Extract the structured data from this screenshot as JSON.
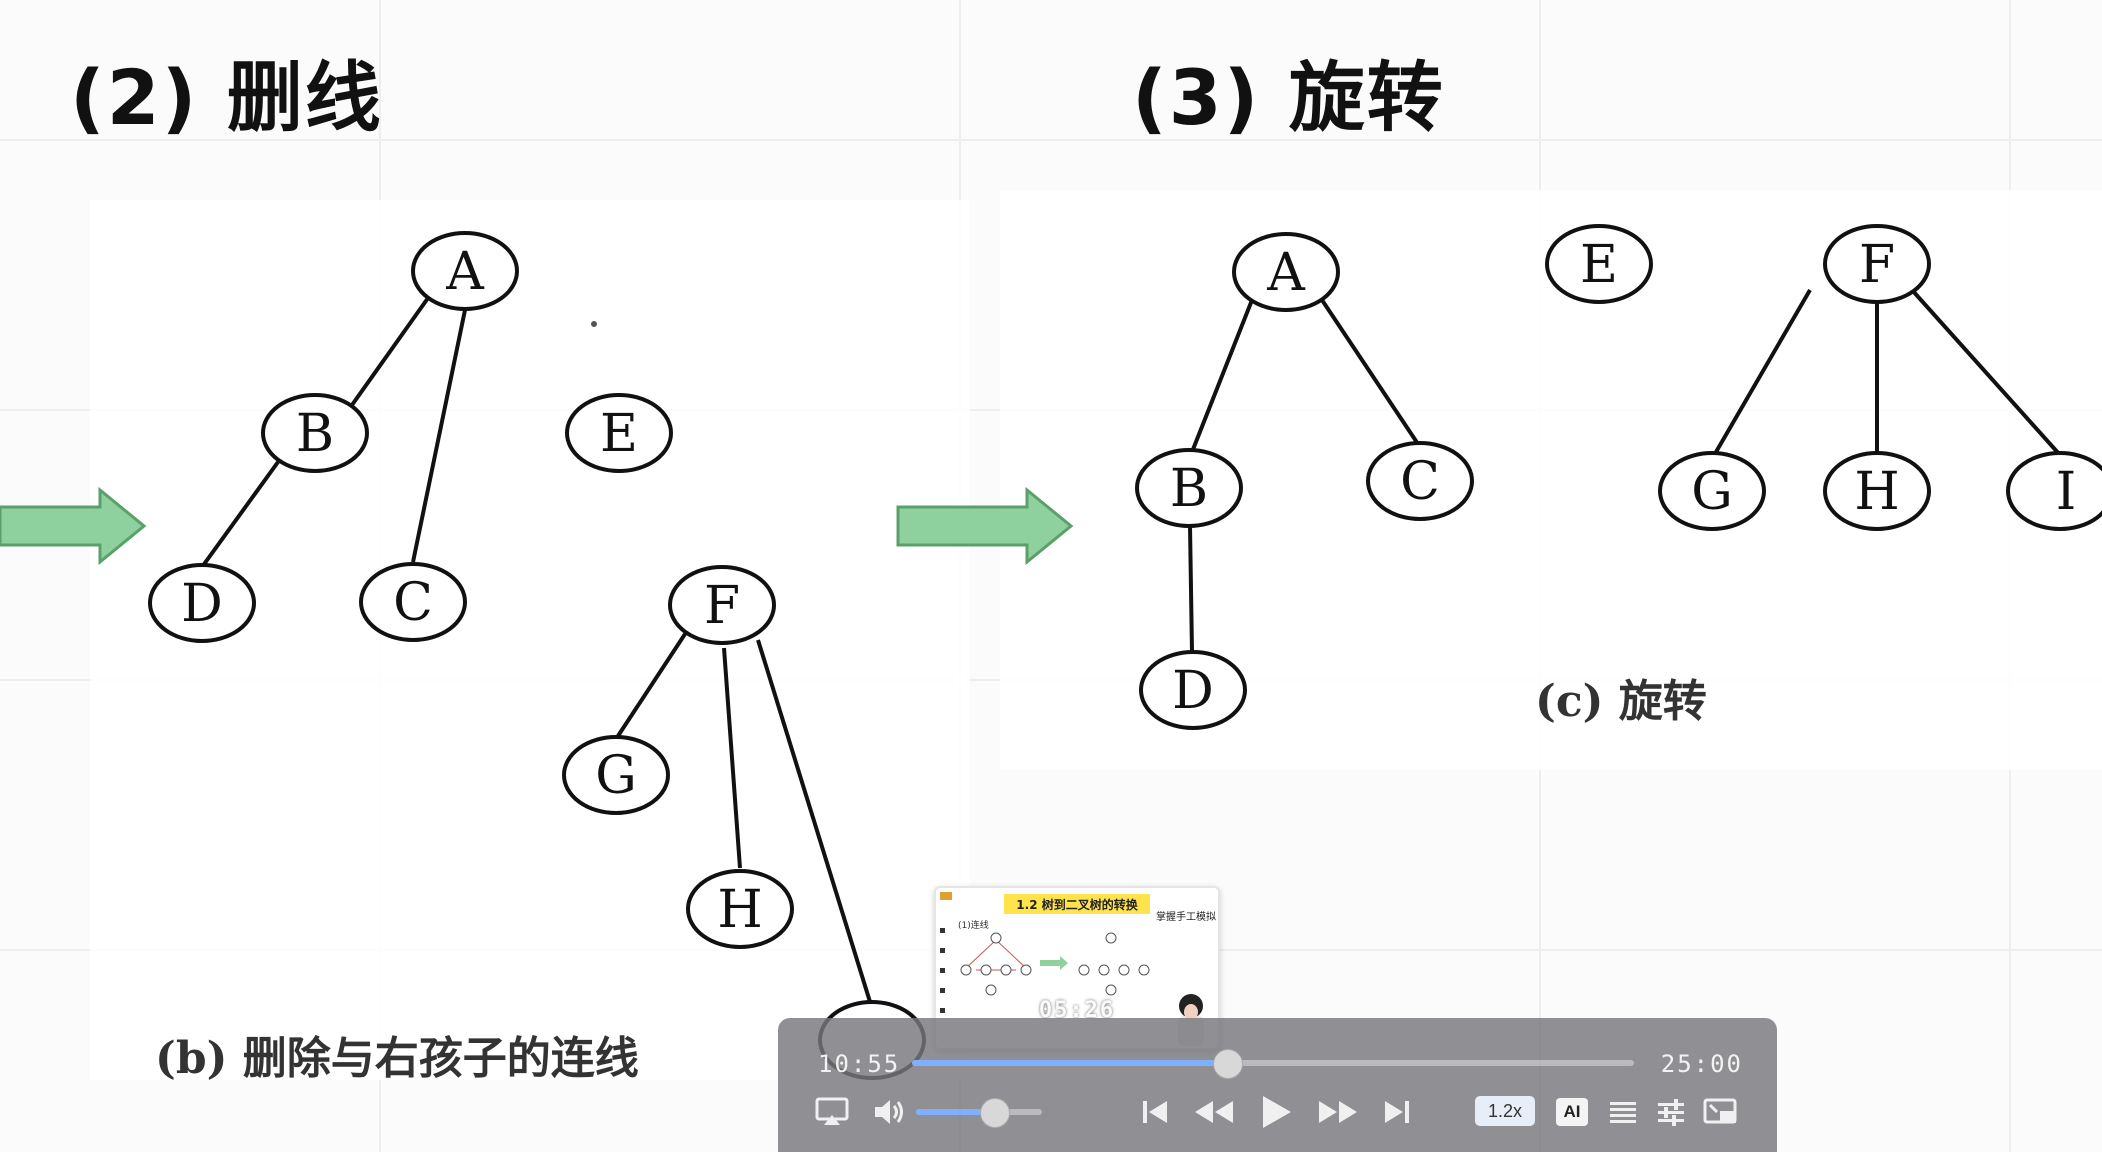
{
  "slide": {
    "title_left": "(2) 删线",
    "title_right": "(3) 旋转",
    "caption_left": "(b) 删除与右孩子的连线",
    "caption_right": "(c) 旋转",
    "arrow_color": "#8fd19e",
    "arrow_border": "#5ba06b",
    "tree_left": {
      "nodes": [
        "A",
        "B",
        "C",
        "D",
        "E",
        "F",
        "G",
        "H",
        "I"
      ],
      "edges": [
        [
          "A",
          "B"
        ],
        [
          "A",
          "C"
        ],
        [
          "B",
          "D"
        ],
        [
          "F",
          "G"
        ],
        [
          "F",
          "H"
        ],
        [
          "F",
          "I"
        ]
      ]
    },
    "tree_right": {
      "nodes": [
        "A",
        "B",
        "C",
        "D",
        "E",
        "F",
        "G",
        "H",
        "I"
      ],
      "edges": [
        [
          "A",
          "B"
        ],
        [
          "A",
          "C"
        ],
        [
          "B",
          "D"
        ],
        [
          "F",
          "G"
        ],
        [
          "F",
          "H"
        ],
        [
          "F",
          "I"
        ]
      ]
    }
  },
  "player": {
    "current_time": "10:55",
    "total_time": "25:00",
    "progress": 0.4367,
    "volume": 0.62,
    "speed_label": "1.2x",
    "ai_label": "AI",
    "accent_color": "#7fb0ff",
    "icons": [
      "airplay-icon",
      "volume-icon",
      "skip-previous-icon",
      "rewind-icon",
      "play-icon",
      "fast-forward-icon",
      "skip-next-icon",
      "playlist-icon",
      "settings-icon",
      "picture-in-picture-icon"
    ],
    "preview": {
      "banner": "1.2 树到二叉树的转换",
      "note": "掌握手工模拟",
      "sub": "(1)连线",
      "time": "05:26"
    }
  }
}
